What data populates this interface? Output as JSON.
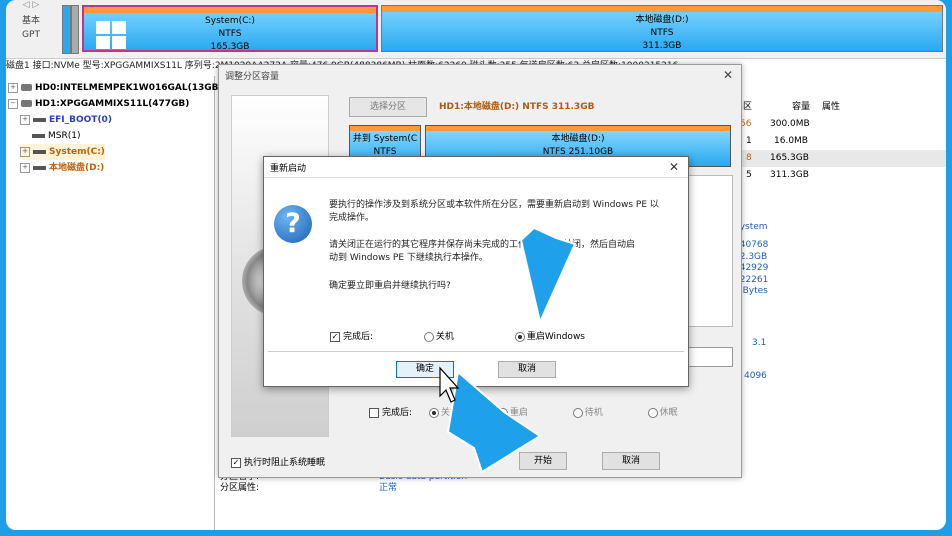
{
  "diskmap": {
    "nav_arrows": "◁ ▷",
    "basic": "基本",
    "gpt": "GPT",
    "partitions": [
      {
        "label": "System(C:)",
        "fs": "NTFS",
        "size": "165.3GB"
      },
      {
        "label": "本地磁盘(D:)",
        "fs": "NTFS",
        "size": "311.3GB"
      }
    ]
  },
  "infobar": "磁盘1 接口:NVMe  型号:XPGGAMMIXS11L  序列号:2M1029AA272A  容量:476.9GB(488386MB)  柱面数:62260  磁头数:255  每道扇区数:63  总扇区数:1000215216",
  "tree": {
    "disk0": "HD0:INTELMEMPEK1W016GAL(13GB",
    "disk1": "HD1:XPGGAMMIXS11L(477GB)",
    "items": [
      "EFI_BOOT(0)",
      "MSR(1)",
      "System(C:)",
      "本地磁盘(D:)"
    ]
  },
  "table": {
    "headers": [
      "扇区",
      "容量",
      "属性"
    ],
    "rows": [
      {
        "sector": "56",
        "size": "300.0MB"
      },
      {
        "sector": "1",
        "size": "16.0MB"
      },
      {
        "sector": "8",
        "size": "165.3GB"
      },
      {
        "sector": "5",
        "size": "311.3GB"
      }
    ]
  },
  "rightinfo": {
    "fsname": "System",
    "lines": [
      "640768",
      "12.3GB",
      "342929",
      "222261",
      "2 Bytes"
    ],
    "ver": "3.1",
    "num": "4096"
  },
  "bottominfo": {
    "type_label": "分区名字:",
    "type_value": "Basic data partition",
    "attr_label": "分区属性:",
    "attr_value": "正常"
  },
  "resize": {
    "title": "调整分区容量",
    "select_btn": "选择分区",
    "path": "HD1:本地磁盘(D:) NTFS 311.3GB",
    "left_label": "并到 System(C",
    "left_fs": "NTFS",
    "right_label": "本地磁盘(D:)",
    "right_fs": "NTFS 251.10GB",
    "after_label": "完成后:",
    "after_options": [
      "关机",
      "重启",
      "待机",
      "休眠"
    ],
    "block_sleep": "执行时阻止系统睡眠",
    "start": "开始",
    "cancel": "取消"
  },
  "restart": {
    "title": "重新启动",
    "msg1a": "要执行的操作涉及到系统分区或本软件所在分区，需要重新启动到 Windows PE 以",
    "msg1b": "完成操作。",
    "msg2a": "请关闭正在运行的其它程序并保存尚未完成的工作，系统将关闭，然后自动启",
    "msg2b": "动到 Windows PE 下继续执行本操作。",
    "msg3": "确定要立即重启并继续执行吗?",
    "after_label": "完成后:",
    "opt_shutdown": "关机",
    "opt_reboot": "重启Windows",
    "ok": "确定",
    "cancel": "取消"
  },
  "colors": {
    "frame": "#1e9ee6",
    "partition": "#2aa9f0",
    "accent_orange": "#ff9a3c",
    "arrow": "#1ea0ea"
  }
}
